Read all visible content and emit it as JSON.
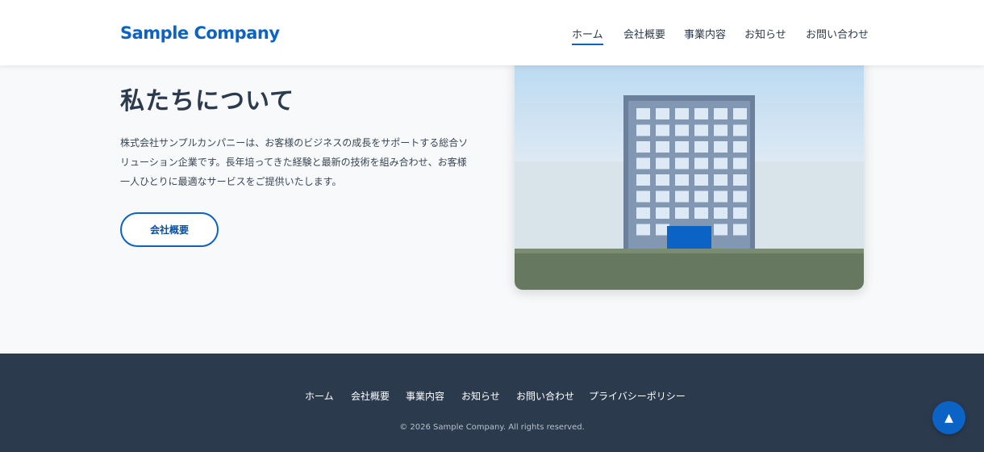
{
  "header": {
    "logo": "Sample Company",
    "nav": [
      {
        "label": "ホーム",
        "active": true
      },
      {
        "label": "会社概要",
        "active": false
      },
      {
        "label": "事業内容",
        "active": false
      },
      {
        "label": "お知らせ",
        "active": false
      },
      {
        "label": "お問い合わせ",
        "active": false
      }
    ]
  },
  "hero": {
    "title": "私たちについて",
    "description": "株式会社サンプルカンパニーは、お客様のビジネスの成長をサポートする総合ソリューション企業です。長年培ってきた経験と最新の技術を組み合わせ、お客様一人ひとりに最適なサービスをご提供いたします。",
    "cta_label": "会社概要"
  },
  "footer": {
    "links": [
      "ホーム",
      "会社概要",
      "事業内容",
      "お知らせ",
      "お問い合わせ",
      "プライバシーポリシー"
    ],
    "copyright": "© 2026 Sample Company. All rights reserved."
  },
  "back_to_top": {
    "icon": "arrow-up-icon",
    "glyph": "▲"
  },
  "colors": {
    "accent": "#0b63c5",
    "dark": "#2b3a4d",
    "background": "#f7f9fb"
  }
}
